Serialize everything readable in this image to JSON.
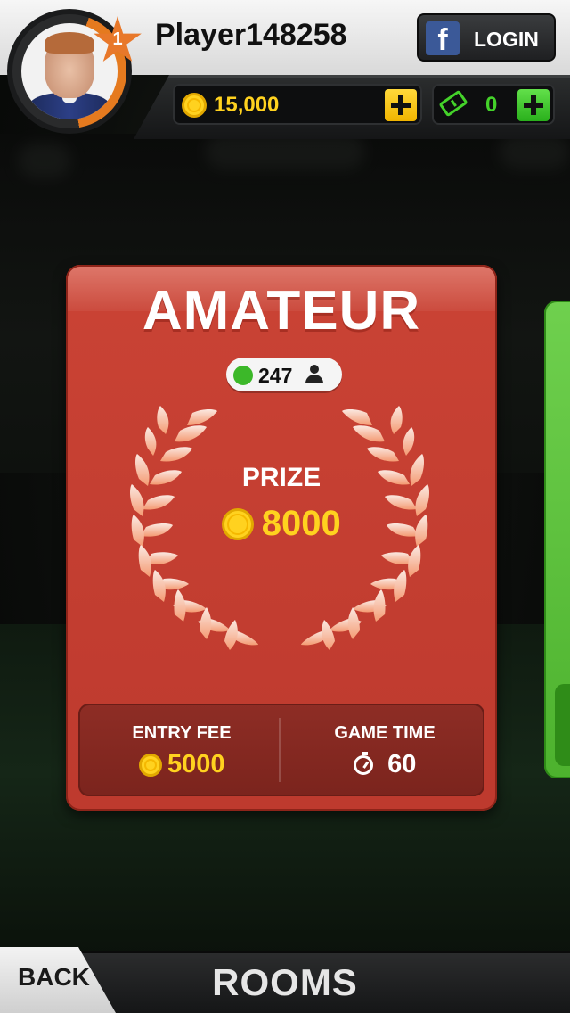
{
  "player": {
    "name": "Player148258",
    "level": "1"
  },
  "header": {
    "login_label": "LOGIN",
    "coins": "15,000",
    "tickets": "0"
  },
  "room": {
    "title": "AMATEUR",
    "players_online": "247",
    "prize_label": "PRIZE",
    "prize_amount": "8000",
    "entry_fee_label": "ENTRY FEE",
    "entry_fee": "5000",
    "game_time_label": "GAME TIME",
    "game_time": "60"
  },
  "footer": {
    "back_label": "BACK",
    "screen_title": "ROOMS"
  },
  "colors": {
    "room_card": "#c94234",
    "coin": "#ffd21f",
    "online": "#3cb829",
    "ticket": "#44d22a",
    "next_room": "#5bbf3b"
  },
  "icons": [
    "facebook-icon",
    "coin-icon",
    "ticket-icon",
    "person-icon",
    "laurel-wreath-icon",
    "stopwatch-icon"
  ]
}
